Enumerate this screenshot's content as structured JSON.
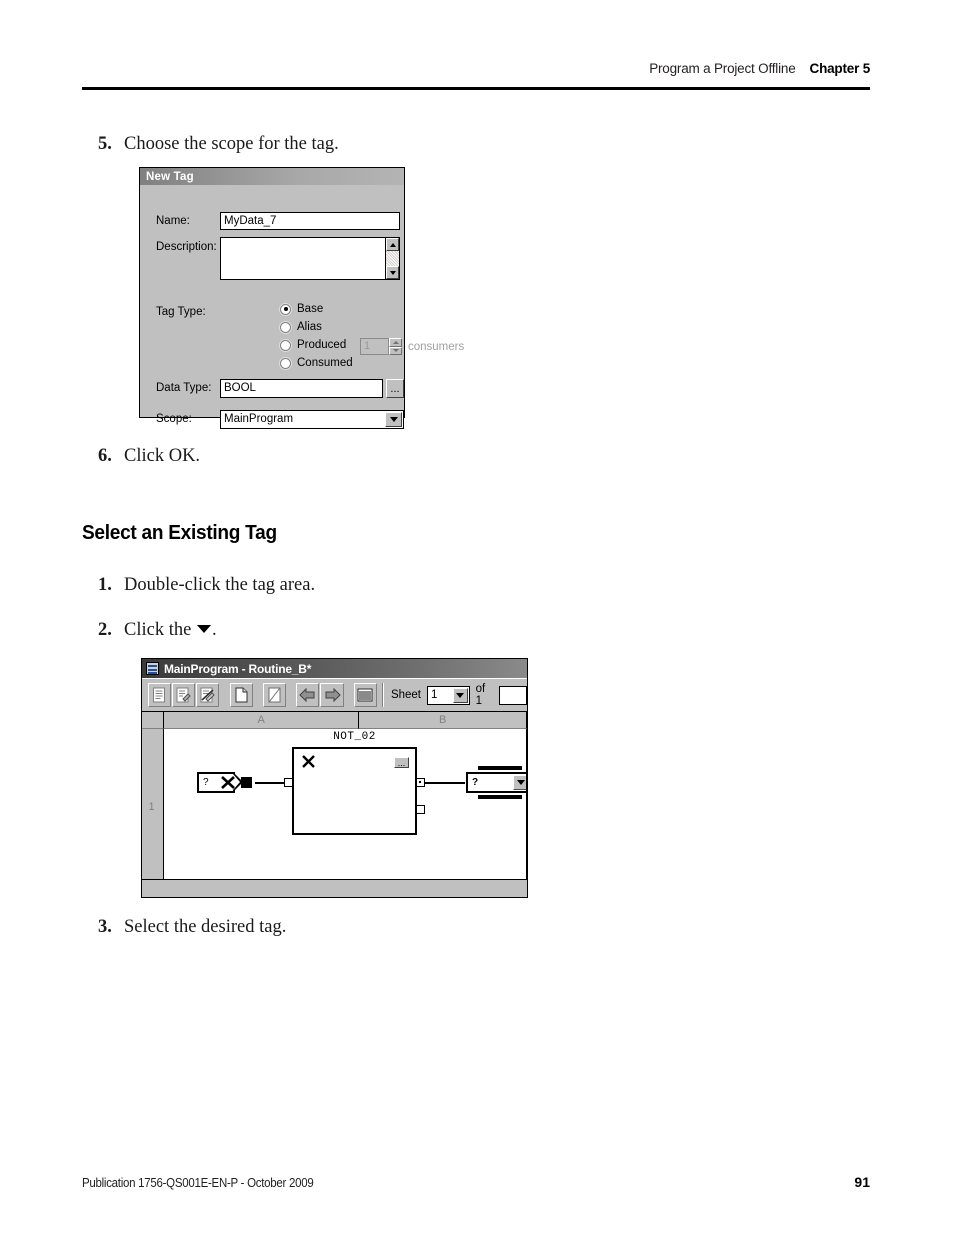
{
  "header": {
    "running_title": "Program a Project Offline",
    "chapter": "Chapter 5"
  },
  "footer": {
    "publication": "Publication 1756-QS001E-EN-P - October 2009",
    "page_number": "91"
  },
  "steps": {
    "step5": {
      "num": "5.",
      "text": "Choose the scope for the tag."
    },
    "step6": {
      "num": "6.",
      "text": "Click OK."
    }
  },
  "section": {
    "heading": "Select an Existing Tag",
    "step1": {
      "num": "1.",
      "text": "Double-click the tag area."
    },
    "step2": {
      "num": "2.",
      "text_before": "Click the ",
      "text_after": "."
    },
    "step3": {
      "num": "3.",
      "text": "Select the desired tag."
    }
  },
  "new_tag_dialog": {
    "title": "New Tag",
    "name_label": "Name:",
    "name_value": "MyData_7",
    "description_label": "Description:",
    "description_value": "",
    "tag_type_label": "Tag Type:",
    "tag_type_options": [
      {
        "label": "Base",
        "selected": true,
        "disabled": false
      },
      {
        "label": "Alias",
        "selected": false,
        "disabled": false
      },
      {
        "label": "Produced",
        "selected": false,
        "disabled": false
      },
      {
        "label": "Consumed",
        "selected": false,
        "disabled": false
      }
    ],
    "consumers_value": "1",
    "consumers_label": "consumers",
    "data_type_label": "Data Type:",
    "data_type_value": "BOOL",
    "browse_button_label": "...",
    "scope_label": "Scope:",
    "scope_value": "MainProgram",
    "scrollbar": {
      "up_icon": "scroll-up-icon",
      "down_icon": "scroll-down-icon"
    }
  },
  "routine_window": {
    "title": "MainProgram - Routine_B*",
    "window_icon": "routine-window-icon",
    "toolbar_buttons": [
      {
        "name": "show-ladder-icon"
      },
      {
        "name": "edit-sheet-icon"
      },
      {
        "name": "verify-routine-icon"
      },
      {
        "name": "new-sheet-icon"
      },
      {
        "name": "delete-sheet-icon"
      },
      {
        "name": "previous-sheet-icon"
      },
      {
        "name": "next-sheet-icon"
      },
      {
        "name": "grid-view-icon"
      }
    ],
    "sheet_label": "Sheet",
    "sheet_value": "1",
    "sheet_of_label": "of 1",
    "columns": [
      "A",
      "B"
    ],
    "row_label": "1",
    "diagram": {
      "block_label": "NOT_02",
      "block_x_icon": "error-x-icon",
      "block_browse_label": "...",
      "input_reference_value": "?",
      "input_reference_x_icon": "error-x-icon",
      "output_reference_value": "?",
      "output_dropdown_icon": "chevron-down-icon"
    }
  }
}
